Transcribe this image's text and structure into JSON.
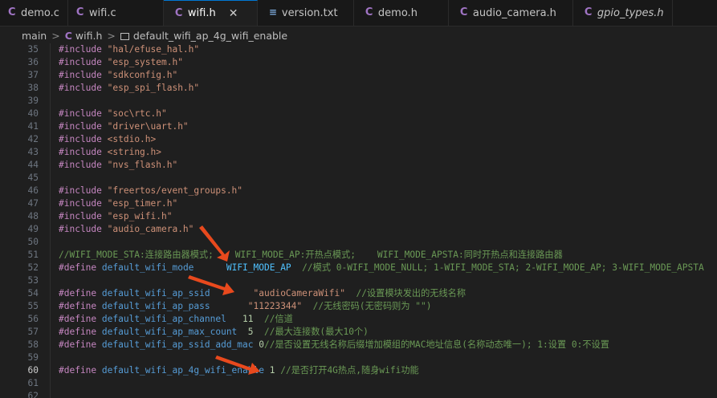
{
  "tabs": [
    {
      "label": "demo.c",
      "icon": "C",
      "type": "c"
    },
    {
      "label": "wifi.c",
      "icon": "C",
      "type": "c"
    },
    {
      "label": "wifi.h",
      "icon": "C",
      "type": "c",
      "active": true
    },
    {
      "label": "version.txt",
      "icon": "≡",
      "type": "txt"
    },
    {
      "label": "demo.h",
      "icon": "C",
      "type": "c"
    },
    {
      "label": "audio_camera.h",
      "icon": "C",
      "type": "c"
    },
    {
      "label": "gpio_types.h",
      "icon": "C",
      "type": "c",
      "italic": true
    }
  ],
  "close_glyph": "✕",
  "breadcrumb": {
    "folder": "main",
    "file_icon": "C",
    "file": "wifi.h",
    "symbol": "default_wifi_ap_4g_wifi_enable",
    "sep": ">"
  },
  "lines": {
    "l35": {
      "n": "35",
      "kw": "#include",
      "str": "\"hal/efuse_hal.h\""
    },
    "l36": {
      "n": "36",
      "kw": "#include",
      "str": "\"esp_system.h\""
    },
    "l37": {
      "n": "37",
      "kw": "#include",
      "str": "\"sdkconfig.h\""
    },
    "l38": {
      "n": "38",
      "kw": "#include",
      "str": "\"esp_spi_flash.h\""
    },
    "l39": {
      "n": "39"
    },
    "l40": {
      "n": "40",
      "kw": "#include",
      "str": "\"soc\\rtc.h\""
    },
    "l41": {
      "n": "41",
      "kw": "#include",
      "str": "\"driver\\uart.h\""
    },
    "l42": {
      "n": "42",
      "kw": "#include",
      "str": "<stdio.h>"
    },
    "l43": {
      "n": "43",
      "kw": "#include",
      "str": "<string.h>"
    },
    "l44": {
      "n": "44",
      "kw": "#include",
      "str": "\"nvs_flash.h\""
    },
    "l45": {
      "n": "45"
    },
    "l46": {
      "n": "46",
      "kw": "#include",
      "str": "\"freertos/event_groups.h\""
    },
    "l47": {
      "n": "47",
      "kw": "#include",
      "str": "\"esp_timer.h\""
    },
    "l48": {
      "n": "48",
      "kw": "#include",
      "str": "\"esp_wifi.h\""
    },
    "l49": {
      "n": "49",
      "kw": "#include",
      "str": "\"audio_camera.h\""
    },
    "l50": {
      "n": "50"
    },
    "l51": {
      "n": "51",
      "cm": "//WIFI_MODE_STA:连接路由器模式;    WIFI_MODE_AP:开热点模式;    WIFI_MODE_APSTA:同时开热点和连接路由器"
    },
    "l52": {
      "n": "52",
      "kw": "#define",
      "name": "default_wifi_mode",
      "pad": "      ",
      "val": "WIFI_MODE_AP",
      "cm": "  //模式 0-WIFI_MODE_NULL; 1-WIFI_MODE_STA; 2-WIFI_MODE_AP; 3-WIFI_MODE_APSTA"
    },
    "l53": {
      "n": "53"
    },
    "l54": {
      "n": "54",
      "kw": "#define",
      "name": "default_wifi_ap_ssid",
      "pad": "        ",
      "val": "\"audioCameraWifi\"",
      "cm": "  //设置模块发出的无线名称"
    },
    "l55": {
      "n": "55",
      "kw": "#define",
      "name": "default_wifi_ap_pass",
      "pad": "       ",
      "val": "\"11223344\"",
      "cm": "  //无线密码(无密码则为 \"\")"
    },
    "l56": {
      "n": "56",
      "kw": "#define",
      "name": "default_wifi_ap_channel",
      "pad": "   ",
      "val": "11",
      "cm": "  //信道"
    },
    "l57": {
      "n": "57",
      "kw": "#define",
      "name": "default_wifi_ap_max_count",
      "pad": "  ",
      "val": "5",
      "cm": "  //最大连接数(最大10个)"
    },
    "l58": {
      "n": "58",
      "kw": "#define",
      "name": "default_wifi_ap_ssid_add_mac",
      "pad": " ",
      "val": "0",
      "cm": "//是否设置无线名称后缀增加模组的MAC地址信息(名称动态唯一); 1:设置 0:不设置"
    },
    "l59": {
      "n": "59"
    },
    "l60": {
      "n": "60",
      "kw": "#define",
      "name": "default_wifi_ap_4g_wifi_enable",
      "pad": " ",
      "val": "1",
      "cm": " //是否打开4G热点,随身wifi功能"
    },
    "l61": {
      "n": "61"
    },
    "l62": {
      "n": "62"
    }
  },
  "colors": {
    "annotation_arrow": "#e8491d",
    "keyword": "#c586c0",
    "string": "#ce9178",
    "macro": "#569cd6",
    "comment": "#6a9955",
    "number": "#b5cea8"
  }
}
